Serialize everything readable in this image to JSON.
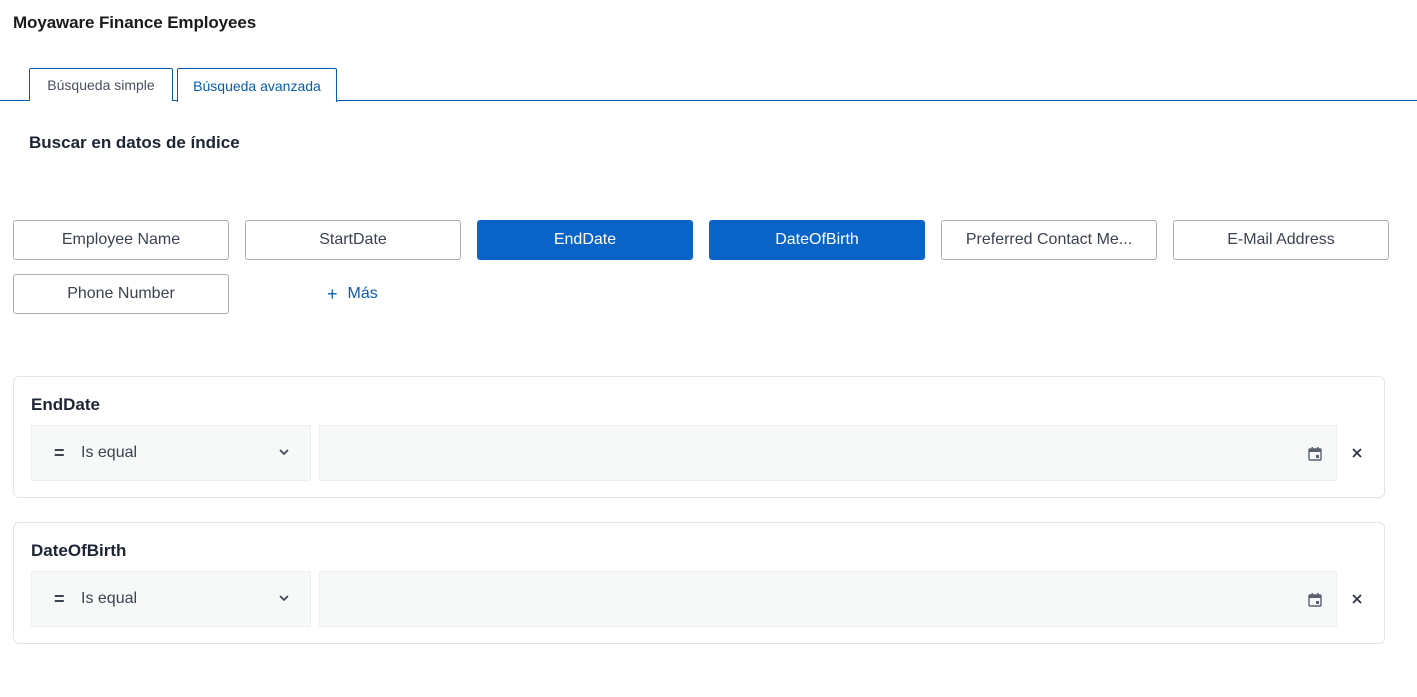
{
  "app": {
    "title": "Moyaware Finance Employees"
  },
  "tabs": {
    "simple": "Búsqueda simple",
    "advanced": "Búsqueda avanzada",
    "active": "advanced"
  },
  "section": {
    "title": "Buscar en datos de índice"
  },
  "fields": [
    {
      "label": "Employee Name",
      "selected": false
    },
    {
      "label": "StartDate",
      "selected": false
    },
    {
      "label": "EndDate",
      "selected": true
    },
    {
      "label": "DateOfBirth",
      "selected": true
    },
    {
      "label": "Preferred Contact Me...",
      "selected": false
    },
    {
      "label": "E-Mail Address",
      "selected": false
    },
    {
      "label": "Phone Number",
      "selected": false
    }
  ],
  "more": {
    "label": "Más",
    "icon": "plus-icon"
  },
  "filters": [
    {
      "title": "EndDate",
      "operator": {
        "symbol": "=",
        "label": "Is equal"
      },
      "value": "",
      "icons": [
        "chevron-down-icon",
        "calendar-icon",
        "close-icon"
      ]
    },
    {
      "title": "DateOfBirth",
      "operator": {
        "symbol": "=",
        "label": "Is equal"
      },
      "value": "",
      "icons": [
        "chevron-down-icon",
        "calendar-icon",
        "close-icon"
      ]
    }
  ],
  "colors": {
    "accent": "#0a64c8",
    "tab_border": "#0b5cad",
    "chip_border": "#a9adb3",
    "input_bg": "#f7f8f8"
  }
}
